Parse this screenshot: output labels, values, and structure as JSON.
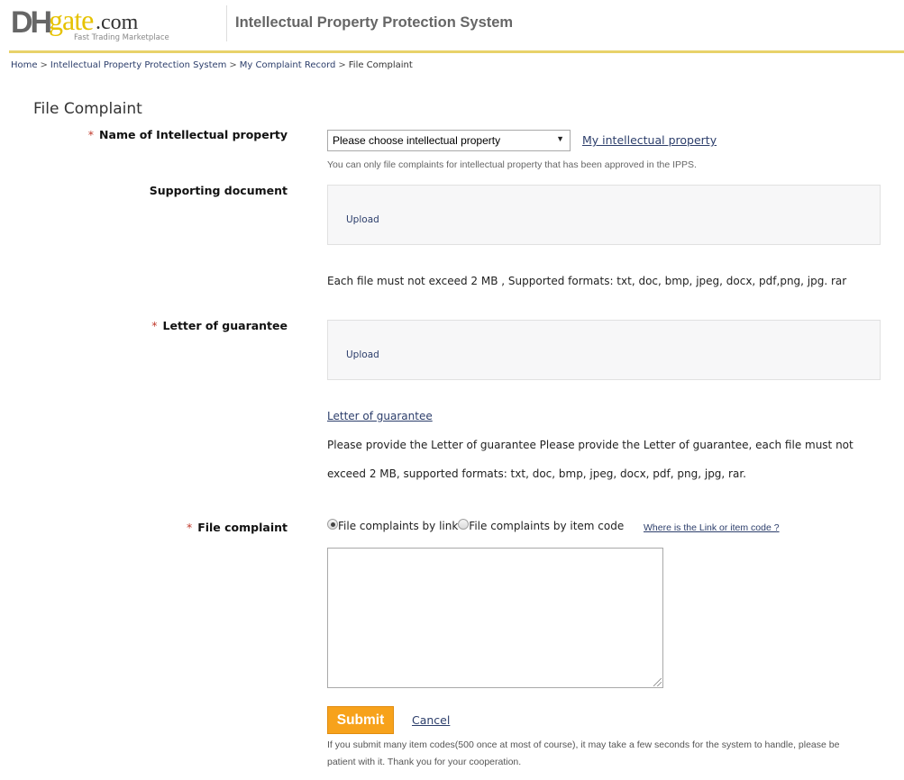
{
  "header": {
    "logo": {
      "dh": "DH",
      "gate": "gate",
      "com": ".com",
      "tagline": "Fast Trading Marketplace"
    },
    "system_title": "Intellectual Property Protection System"
  },
  "breadcrumb": [
    {
      "label": "Home"
    },
    {
      "label": "Intellectual Property Protection System"
    },
    {
      "label": "My Complaint Record"
    },
    {
      "label": "File Complaint"
    }
  ],
  "breadcrumb_separator": ">",
  "page_title": "File Complaint",
  "form": {
    "required_mark": "*",
    "ip_name": {
      "label": "Name of Intellectual property",
      "select_value": "Please choose intellectual property",
      "link": "My intellectual property",
      "hint": "You can only file complaints for intellectual property that has been approved in the IPPS."
    },
    "supporting_document": {
      "label": "Supporting document",
      "upload_label": "Upload",
      "hint": "Each file must not exceed 2 MB , Supported formats: txt, doc, bmp, jpeg, docx, pdf,png, jpg. rar"
    },
    "letter_of_guarantee": {
      "label": "Letter of guarantee",
      "upload_label": "Upload",
      "link": "Letter of guarantee",
      "hint_line1": "Please provide the Letter of guarantee Please provide the Letter of guarantee, each file must not",
      "hint_line2": "exceed 2 MB, supported formats: txt, doc, bmp, jpeg, docx, pdf, png, jpg, rar."
    },
    "file_complaint": {
      "label": "File complaint",
      "options": [
        {
          "label": "File complaints by link",
          "checked": true
        },
        {
          "label": "File complaints by item code",
          "checked": false
        }
      ],
      "help_link": "Where is the Link or item code ?",
      "textarea_value": ""
    },
    "submit_label": "Submit",
    "cancel_label": "Cancel",
    "note_line1": "If you submit many item codes(500 once at most of course), it may take a few seconds for the system to handle, please be",
    "note_line2": "patient with it. Thank you for your cooperation."
  },
  "colors": {
    "accent_yellow": "#e8d26a",
    "submit_orange": "#f7a21b",
    "link_blue": "#2c3e6b",
    "required_red": "#c0392b"
  }
}
